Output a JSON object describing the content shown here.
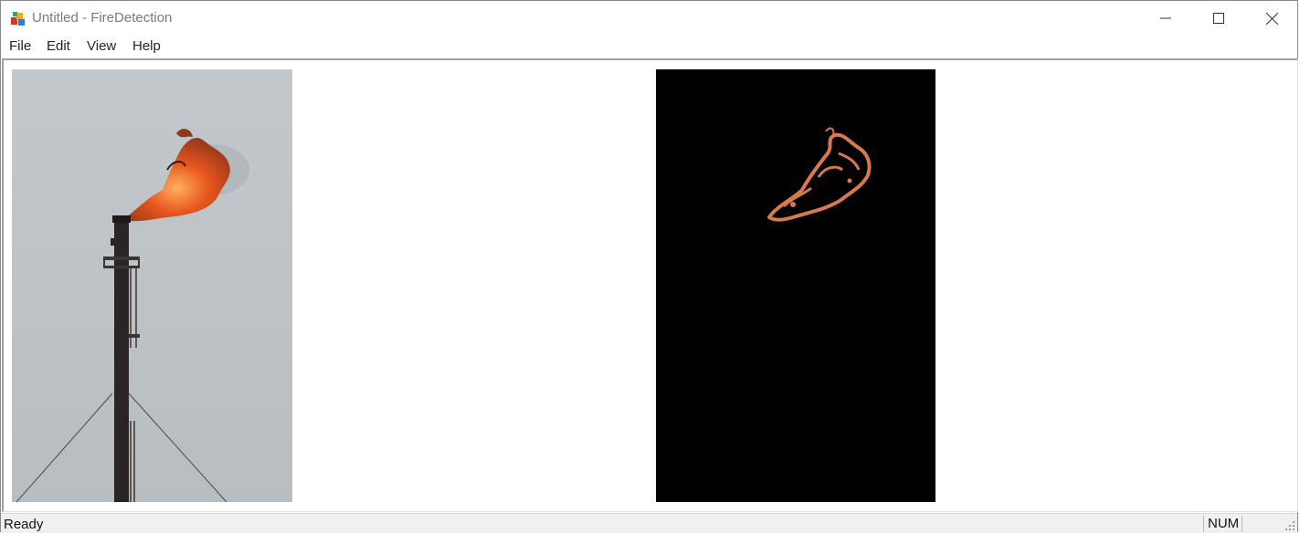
{
  "window": {
    "title": "Untitled - FireDetection",
    "controls": [
      "minimize-icon",
      "maximize-icon",
      "close-icon"
    ]
  },
  "menu": {
    "items": [
      {
        "label": "File"
      },
      {
        "label": "Edit"
      },
      {
        "label": "View"
      },
      {
        "label": "Help"
      }
    ]
  },
  "views": {
    "original": {
      "kind": "source-frame",
      "description_icon": "flare-stack-image"
    },
    "detected": {
      "kind": "fire-mask",
      "description_icon": "fire-mask-image"
    }
  },
  "status": {
    "text": "Ready",
    "indicators": [
      "NUM",
      ""
    ]
  },
  "colors": {
    "title_text": "#7a7a7a",
    "status_bg": "#f0f0f0",
    "mask_bg": "#000000",
    "flame": "#e86a2a"
  }
}
